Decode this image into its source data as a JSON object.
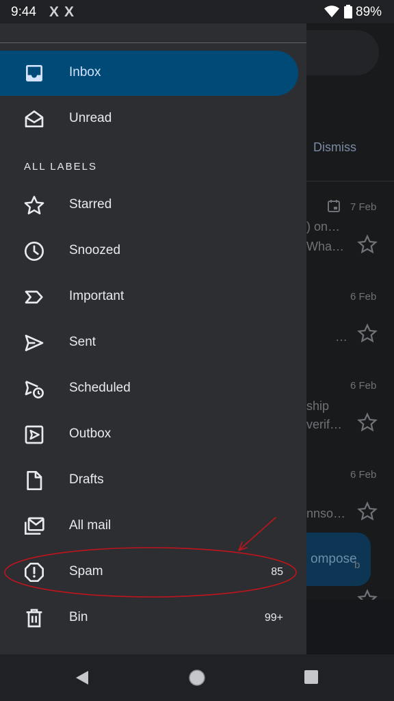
{
  "status_bar": {
    "time": "9:44",
    "battery": "89%",
    "notification_icons": [
      "x-icon",
      "x-icon"
    ]
  },
  "drawer": {
    "section_label": "ALL LABELS",
    "items": [
      {
        "label": "Inbox",
        "icon": "inbox-icon",
        "selected": true
      },
      {
        "label": "Unread",
        "icon": "open-mail-icon"
      },
      {
        "label": "Starred",
        "icon": "star-icon"
      },
      {
        "label": "Snoozed",
        "icon": "clock-icon"
      },
      {
        "label": "Important",
        "icon": "important-icon"
      },
      {
        "label": "Sent",
        "icon": "send-icon"
      },
      {
        "label": "Scheduled",
        "icon": "scheduled-send-icon"
      },
      {
        "label": "Outbox",
        "icon": "outbox-icon"
      },
      {
        "label": "Drafts",
        "icon": "draft-icon"
      },
      {
        "label": "All mail",
        "icon": "all-mail-icon"
      },
      {
        "label": "Spam",
        "icon": "spam-icon",
        "count": "85"
      },
      {
        "label": "Bin",
        "icon": "trash-icon",
        "count": "99+"
      }
    ]
  },
  "background": {
    "dismiss_label": "Dismiss",
    "compose_label": "ompose",
    "emails": [
      {
        "date": "7 Feb",
        "line1": ") on…",
        "line2": "Wha…"
      },
      {
        "date": "6 Feb",
        "line1": "",
        "line2": "…"
      },
      {
        "date": "6 Feb",
        "line1": "ship",
        "line2": "verif…"
      },
      {
        "date": "6 Feb",
        "line1": "",
        "line2": "nnso…"
      }
    ],
    "peek_date": "b"
  },
  "colors": {
    "accent": "#004a77",
    "drawer_bg": "#2d2e32",
    "annotation": "#c0141c"
  }
}
